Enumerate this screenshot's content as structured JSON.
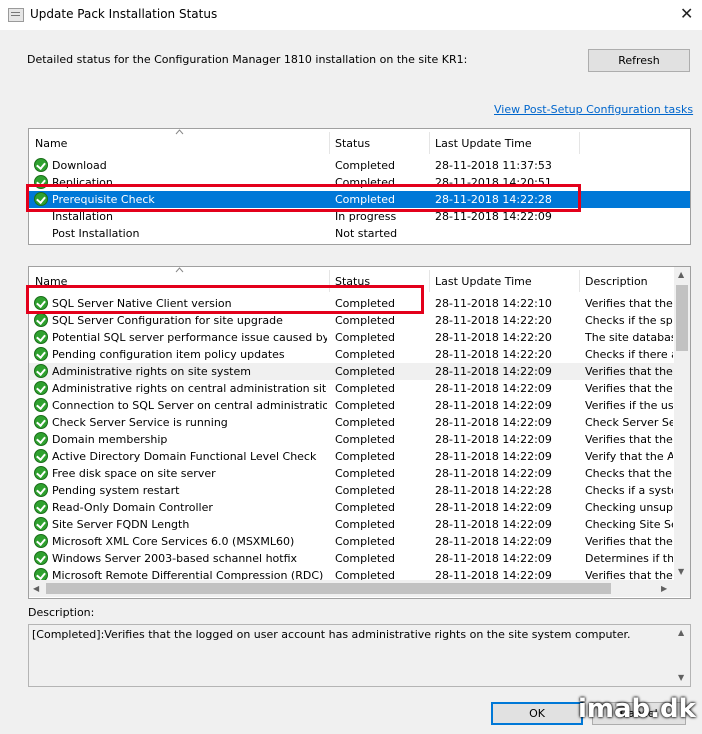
{
  "window": {
    "title": "Update Pack Installation Status",
    "close_glyph": "✕"
  },
  "intro_text": "Detailed status for the Configuration Manager 1810 installation on the site KR1:",
  "refresh_label": "Refresh",
  "post_setup_link": "View Post-Setup Configuration tasks",
  "phases_table": {
    "columns": [
      "Name",
      "Status",
      "Last Update Time"
    ],
    "rows": [
      {
        "name": "Download",
        "status": "Completed",
        "time": "28-11-2018 11:37:53",
        "icon": "check-icon"
      },
      {
        "name": "Replication",
        "status": "Completed",
        "time": "28-11-2018 14:20:51",
        "icon": "check-icon"
      },
      {
        "name": "Prerequisite Check",
        "status": "Completed",
        "time": "28-11-2018 14:22:28",
        "icon": "check-icon"
      },
      {
        "name": "Installation",
        "status": "In progress",
        "time": "28-11-2018 14:22:09",
        "icon": "none"
      },
      {
        "name": "Post Installation",
        "status": "Not started",
        "time": "",
        "icon": "none"
      }
    ]
  },
  "checks_table": {
    "columns": [
      "Name",
      "Status",
      "Last Update Time",
      "Description"
    ],
    "rows": [
      {
        "name": "SQL Server Native Client version",
        "status": "Completed",
        "time": "28-11-2018 14:22:10",
        "desc": "Verifies that the ve"
      },
      {
        "name": "SQL Server Configuration for site upgrade",
        "status": "Completed",
        "time": "28-11-2018 14:22:20",
        "desc": "Checks if the spec"
      },
      {
        "name": "Potential SQL server performance issue caused by chan...",
        "status": "Completed",
        "time": "28-11-2018 14:22:20",
        "desc": "The site database"
      },
      {
        "name": "Pending configuration item policy updates",
        "status": "Completed",
        "time": "28-11-2018 14:22:20",
        "desc": "Checks if there are"
      },
      {
        "name": "Administrative rights on site system",
        "status": "Completed",
        "time": "28-11-2018 14:22:09",
        "desc": "Verifies that the log"
      },
      {
        "name": "Administrative rights on central administration site",
        "status": "Completed",
        "time": "28-11-2018 14:22:09",
        "desc": "Verifies that the us"
      },
      {
        "name": "Connection to SQL Server on central administration site",
        "status": "Completed",
        "time": "28-11-2018 14:22:09",
        "desc": "Verifies if the user"
      },
      {
        "name": "Check Server Service is running",
        "status": "Completed",
        "time": "28-11-2018 14:22:09",
        "desc": "Check Server Serv"
      },
      {
        "name": "Domain membership",
        "status": "Completed",
        "time": "28-11-2018 14:22:09",
        "desc": "Verifies that the co"
      },
      {
        "name": "Active Directory Domain Functional Level Check",
        "status": "Completed",
        "time": "28-11-2018 14:22:09",
        "desc": "Verify that the Activ"
      },
      {
        "name": "Free disk space on site server",
        "status": "Completed",
        "time": "28-11-2018 14:22:09",
        "desc": "Checks that the sit"
      },
      {
        "name": "Pending system restart",
        "status": "Completed",
        "time": "28-11-2018 14:22:28",
        "desc": "Checks if a system"
      },
      {
        "name": "Read-Only Domain Controller",
        "status": "Completed",
        "time": "28-11-2018 14:22:09",
        "desc": "Checking unsuppo"
      },
      {
        "name": "Site Server FQDN Length",
        "status": "Completed",
        "time": "28-11-2018 14:22:09",
        "desc": "Checking Site Serv"
      },
      {
        "name": "Microsoft XML Core Services 6.0 (MSXML60)",
        "status": "Completed",
        "time": "28-11-2018 14:22:09",
        "desc": "Verifies that the Mi"
      },
      {
        "name": "Windows Server 2003-based schannel hotfix",
        "status": "Completed",
        "time": "28-11-2018 14:22:09",
        "desc": "Determines if the W"
      },
      {
        "name": "Microsoft Remote Differential Compression (RDC) library r...",
        "status": "Completed",
        "time": "28-11-2018 14:22:09",
        "desc": "Verifies that the Mi"
      }
    ]
  },
  "description_label": "Description:",
  "description_text": "[Completed]:Verifies that the logged on user account has administrative rights on the site system computer.",
  "ok_label": "OK",
  "cancel_label": "Cancel",
  "watermark": "imab.dk",
  "colors": {
    "selection": "#0078d7",
    "highlight_box": "#e3001b",
    "link": "#0066cc",
    "check": "#2fa12f"
  }
}
